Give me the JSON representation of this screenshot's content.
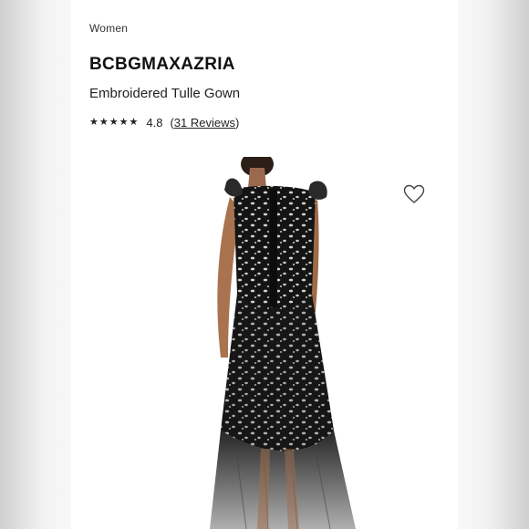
{
  "breadcrumb": "Women",
  "product": {
    "brand": "BCBGMAXAZRIA",
    "name": "Embroidered Tulle Gown",
    "rating": {
      "stars": 4.8,
      "score_text": "4.8",
      "open_paren": "(",
      "reviews_link": "31 Reviews",
      "close_paren": ")"
    }
  },
  "icons": {
    "star": "★",
    "wishlist": "heart-outline-icon"
  },
  "colors": {
    "text": "#222222",
    "dress": "#151515",
    "embroidery": "#f2f0e8"
  }
}
